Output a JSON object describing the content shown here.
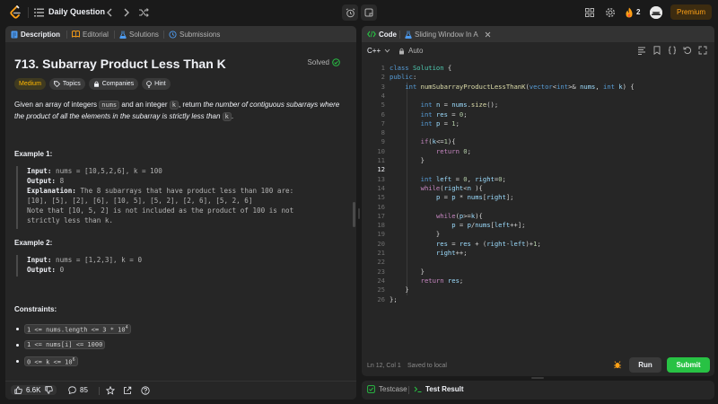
{
  "topbar": {
    "title": "Daily Question",
    "streak": "2",
    "premium_label": "Premium"
  },
  "left_tabs": {
    "description": "Description",
    "editorial": "Editorial",
    "solutions": "Solutions",
    "submissions": "Submissions"
  },
  "problem": {
    "title": "713. Subarray Product Less Than K",
    "status": "Solved",
    "chips": [
      "Medium",
      "Topics",
      "Companies",
      "Hint"
    ],
    "desc_parts": {
      "p1": "Given an array of integers ",
      "c1": "nums",
      "p2": " and an integer ",
      "c2": "k",
      "p3": ", return ",
      "p4": "the number of contiguous subarrays where the product of all the elements in the subarray is strictly less than ",
      "c3": "k",
      "p5": "."
    },
    "example1": {
      "heading": "Example 1:",
      "input_label": "Input:",
      "input": " nums = [10,5,2,6], k = 100",
      "output_label": "Output:",
      "output": " 8",
      "explanation_label": "Explanation:",
      "explanation": " The 8 subarrays that have product less than 100 are:",
      "line2": "[10], [5], [2], [6], [10, 5], [5, 2], [2, 6], [5, 2, 6]",
      "line3": "Note that [10, 5, 2] is not included as the product of 100 is not",
      "line4": "strictly less than k."
    },
    "example2": {
      "heading": "Example 2:",
      "input_label": "Input:",
      "input": " nums = [1,2,3], k = 0",
      "output_label": "Output:",
      "output": " 0"
    },
    "constraints_heading": "Constraints:",
    "constraints": [
      "1 <= nums.length <= 3 * 10",
      "1 <= nums[i] <= 1000",
      "0 <= k <= 10"
    ],
    "constraint_exps": [
      "4",
      "6"
    ]
  },
  "left_footer": {
    "likes": "6.6K",
    "comments": "85"
  },
  "code_tabs": {
    "code": "Code",
    "file": "Sliding Window In A"
  },
  "editor": {
    "language": "C++",
    "mode": "Auto",
    "cursor_line": 12,
    "lines": [
      "class Solution {",
      "public:",
      "    int numSubarrayProductLessThanK(vector<int>& nums, int k) {",
      "",
      "        int n = nums.size();",
      "        int res = 0;",
      "        int p = 1;",
      "",
      "        if(k<=1){",
      "            return 0;",
      "        }",
      "",
      "        int left = 0, right=0;",
      "        while(right<n ){",
      "            p = p * nums[right];",
      "",
      "            while(p>=k){",
      "                p = p/nums[left++];",
      "            }",
      "            res = res + (right-left)+1;",
      "            right++;",
      "",
      "        }",
      "        return res;",
      "    }",
      "};"
    ],
    "status": "Ln 12, Col 1",
    "saved": "Saved to local",
    "run_label": "Run",
    "submit_label": "Submit"
  },
  "bottom_tabs": {
    "testcase": "Testcase",
    "result": "Test Result"
  },
  "colors": {
    "accent_orange": "#ffa116",
    "submit_green": "#28c244",
    "medium_yellow": "#ffb800",
    "solved_green": "#28c244"
  }
}
